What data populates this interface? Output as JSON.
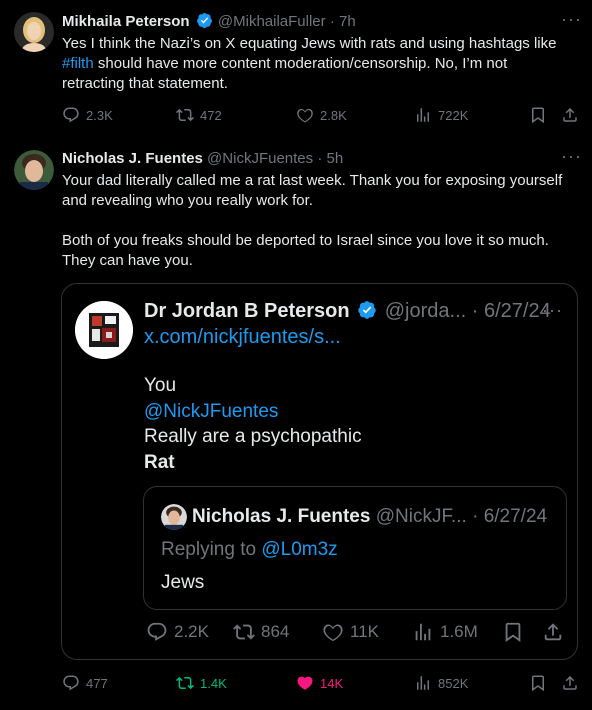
{
  "tweet1": {
    "name": "Mikhaila Peterson",
    "handle": "@MikhailaFuller",
    "sep": "·",
    "time": "7h",
    "text_a": "Yes I think the Nazi’s on X equating Jews with rats and using hashtags like",
    "hashtag": "#filth",
    "text_b": " should have more content moderation/censorship. No, I’m not",
    "text_c": "retracting that statement.",
    "replies": "2.3K",
    "reposts": "472",
    "likes": "2.8K",
    "views": "722K"
  },
  "tweet2": {
    "name": "Nicholas J. Fuentes",
    "handle": "@NickJFuentes",
    "sep": "·",
    "time": "5h",
    "p1_l1": "Your dad literally called me a rat last week. Thank you for exposing yourself",
    "p1_l2": "and revealing who you really work for.",
    "p2_l1": "Both of you freaks should be deported to Israel since you love it so much.",
    "p2_l2": "They can have you.",
    "replies": "477",
    "reposts": "1.4K",
    "likes": "14K",
    "views": "852K"
  },
  "quote": {
    "name": "Dr Jordan B Peterson",
    "handle": "@jorda...",
    "sep": "·",
    "date": "6/27/24",
    "link": "x.com/nickjfuentes/s...",
    "line1": "You",
    "mention": "@NickJFuentes",
    "line3": "Really are a psychopathic",
    "line4": "Rat",
    "replies": "2.2K",
    "reposts": "864",
    "likes": "11K",
    "views": "1.6M"
  },
  "nested": {
    "name": "Nicholas J. Fuentes",
    "handle": "@NickJF...",
    "sep": "·",
    "date": "6/27/24",
    "replying_to": "Replying to",
    "replying_handle": "@L0m3z",
    "text": "Jews"
  },
  "colors": {
    "background": "#000000",
    "text": "#e7e9ea",
    "muted": "#71767b",
    "link": "#1d9bf0",
    "verified": "#1d9bf0",
    "repost_active": "#00ba7c",
    "like_active": "#f91880",
    "border": "#2f3336"
  },
  "icons": [
    "verified-badge-icon",
    "more-icon",
    "reply-icon",
    "repost-icon",
    "like-icon",
    "views-icon",
    "bookmark-icon",
    "share-icon"
  ]
}
